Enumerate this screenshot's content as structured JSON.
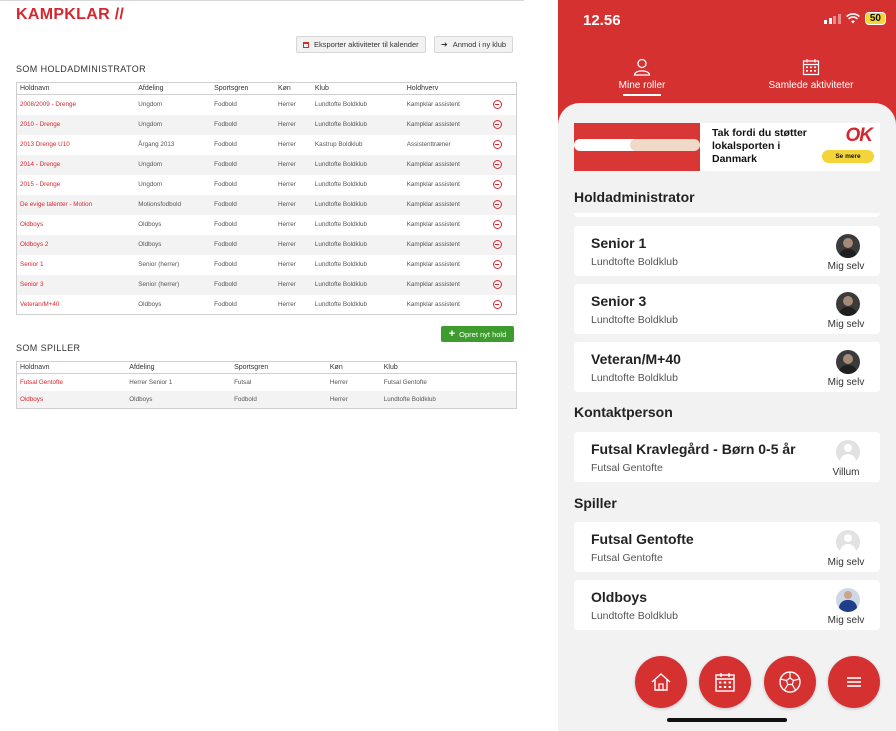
{
  "web": {
    "logo": "KAMPKLAR //",
    "export_button": "Eksporter aktiviteter til kalender",
    "request_button": "Anmod i ny klub",
    "admin_section_title": "SOM HOLDADMINISTRATOR",
    "admin_columns": [
      "Holdnavn",
      "Afdeling",
      "Sportsgren",
      "Køn",
      "Klub",
      "Holdhverv"
    ],
    "admin_rows": [
      [
        "2008/2009 - Drenge",
        "Ungdom",
        "Fodbold",
        "Herrer",
        "Lundtofte Boldklub",
        "Kampklar assistent"
      ],
      [
        "2010 - Drenge",
        "Ungdom",
        "Fodbold",
        "Herrer",
        "Lundtofte Boldklub",
        "Kampklar assistent"
      ],
      [
        "2013 Drenge U10",
        "Årgang 2013",
        "Fodbold",
        "Herrer",
        "Kastrup Boldklub",
        "Assistenttræner"
      ],
      [
        "2014 - Drenge",
        "Ungdom",
        "Fodbold",
        "Herrer",
        "Lundtofte Boldklub",
        "Kampklar assistent"
      ],
      [
        "2015 - Drenge",
        "Ungdom",
        "Fodbold",
        "Herrer",
        "Lundtofte Boldklub",
        "Kampklar assistent"
      ],
      [
        "De evige talenter - Motion",
        "Motionsfodbold",
        "Fodbold",
        "Herrer",
        "Lundtofte Boldklub",
        "Kampklar assistent"
      ],
      [
        "Oldboys",
        "Oldboys",
        "Fodbold",
        "Herrer",
        "Lundtofte Boldklub",
        "Kampklar assistent"
      ],
      [
        "Oldboys 2",
        "Oldboys",
        "Fodbold",
        "Herrer",
        "Lundtofte Boldklub",
        "Kampklar assistent"
      ],
      [
        "Senior 1",
        "Senior (herrer)",
        "Fodbold",
        "Herrer",
        "Lundtofte Boldklub",
        "Kampklar assistent"
      ],
      [
        "Senior 3",
        "Senior (herrer)",
        "Fodbold",
        "Herrer",
        "Lundtofte Boldklub",
        "Kampklar assistent"
      ],
      [
        "Veteran/M+40",
        "Oldboys",
        "Fodbold",
        "Herrer",
        "Lundtofte Boldklub",
        "Kampklar assistent"
      ]
    ],
    "create_button": "Opret nyt hold",
    "player_section_title": "SOM SPILLER",
    "player_columns": [
      "Holdnavn",
      "Afdeling",
      "Sportsgren",
      "Køn",
      "Klub"
    ],
    "player_rows": [
      [
        "Futsal Gentofte",
        "Herrer Senior 1",
        "Futsal",
        "Herrer",
        "Futsal Gentofte"
      ],
      [
        "Oldboys",
        "Oldboys",
        "Fodbold",
        "Herrer",
        "Lundtofte Boldklub"
      ]
    ]
  },
  "phone": {
    "time": "12.56",
    "battery": "50",
    "tabs": [
      "Mine roller",
      "Samlede aktiviteter"
    ],
    "banner_text": "Tak fordi du støtter lokalsporten i Danmark",
    "banner_logo": "OK",
    "banner_button": "Se mere",
    "sections": {
      "admin": "Holdadministrator",
      "contact": "Kontaktperson",
      "player": "Spiller"
    },
    "admin_cards": [
      {
        "title": "Senior 1",
        "club": "Lundtofte Boldklub",
        "who": "Mig selv",
        "avatar": "dark"
      },
      {
        "title": "Senior 3",
        "club": "Lundtofte Boldklub",
        "who": "Mig selv",
        "avatar": "dark"
      },
      {
        "title": "Veteran/M+40",
        "club": "Lundtofte Boldklub",
        "who": "Mig selv",
        "avatar": "dark"
      }
    ],
    "contact_cards": [
      {
        "title": "Futsal Kravlegård - Børn 0-5 år",
        "club": "Futsal Gentofte",
        "who": "Villum",
        "avatar": "grey"
      }
    ],
    "player_cards": [
      {
        "title": "Futsal Gentofte",
        "club": "Futsal Gentofte",
        "who": "Mig selv",
        "avatar": "grey"
      },
      {
        "title": "Oldboys",
        "club": "Lundtofte Boldklub",
        "who": "Mig selv",
        "avatar": "blue"
      }
    ],
    "bottom_nav": [
      "home-icon",
      "calendar-icon",
      "ball-icon",
      "menu-icon"
    ],
    "colors": {
      "brand": "#d63131",
      "accent": "#f3d43a",
      "success": "#3e9b2e"
    }
  }
}
